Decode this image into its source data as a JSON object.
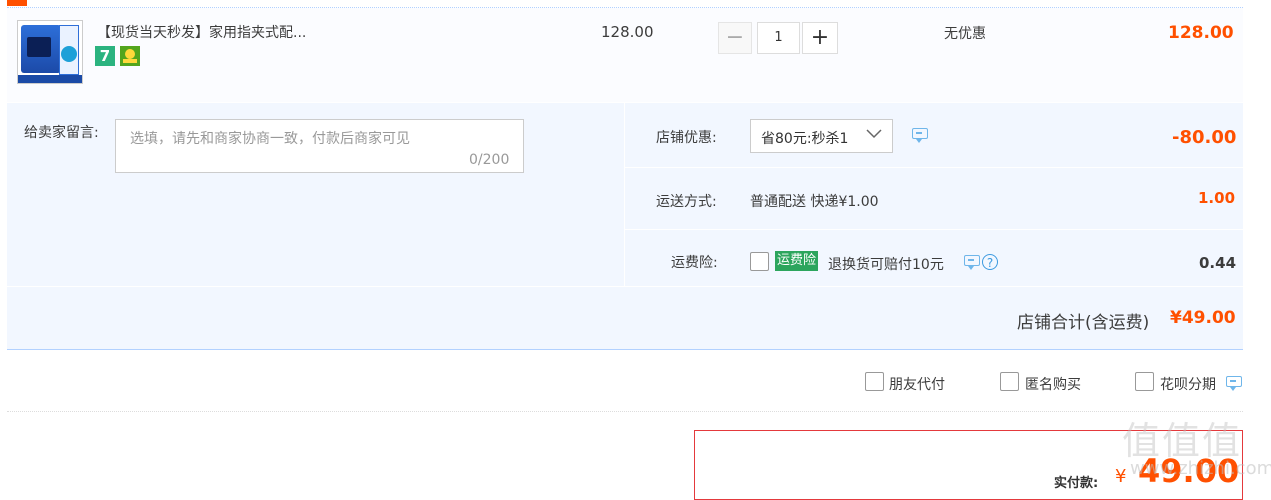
{
  "product": {
    "title": "【现货当天秒发】家用指夹式配...",
    "badge_7": "7",
    "unit_price": "128.00",
    "quantity": "1",
    "minus_glyph": "−",
    "plus_glyph": "+",
    "discount_text": "无优惠",
    "subtotal": "128.00"
  },
  "message": {
    "label": "给卖家留言:",
    "placeholder": "选填，请先和商家协商一致，付款后商家可见",
    "count": "0/200"
  },
  "coupon": {
    "label": "店铺优惠:",
    "value": "省80元:秒杀1",
    "amount": "-80.00"
  },
  "shipping": {
    "label": "运送方式:",
    "value": "普通配送 快递¥1.00",
    "amount": "1.00"
  },
  "insurance": {
    "label": "运费险:",
    "tag": "运费险",
    "desc": "退换货可赔付10元",
    "help": "?",
    "amount": "0.44"
  },
  "store_total": {
    "label": "店铺合计(含运费)",
    "amount": "¥49.00"
  },
  "options": {
    "friend": "朋友代付",
    "anonymous": "匿名购买",
    "huabei": "花呗分期"
  },
  "payment": {
    "label": "实付款:",
    "symbol": "¥",
    "amount": "49.00"
  },
  "watermark": {
    "text": "值值值",
    "url": "www.zhizhi.com"
  },
  "colors": {
    "accent": "#ff5000",
    "panel_bg": "#f2f7ff",
    "tag_green": "#2ca55d"
  }
}
